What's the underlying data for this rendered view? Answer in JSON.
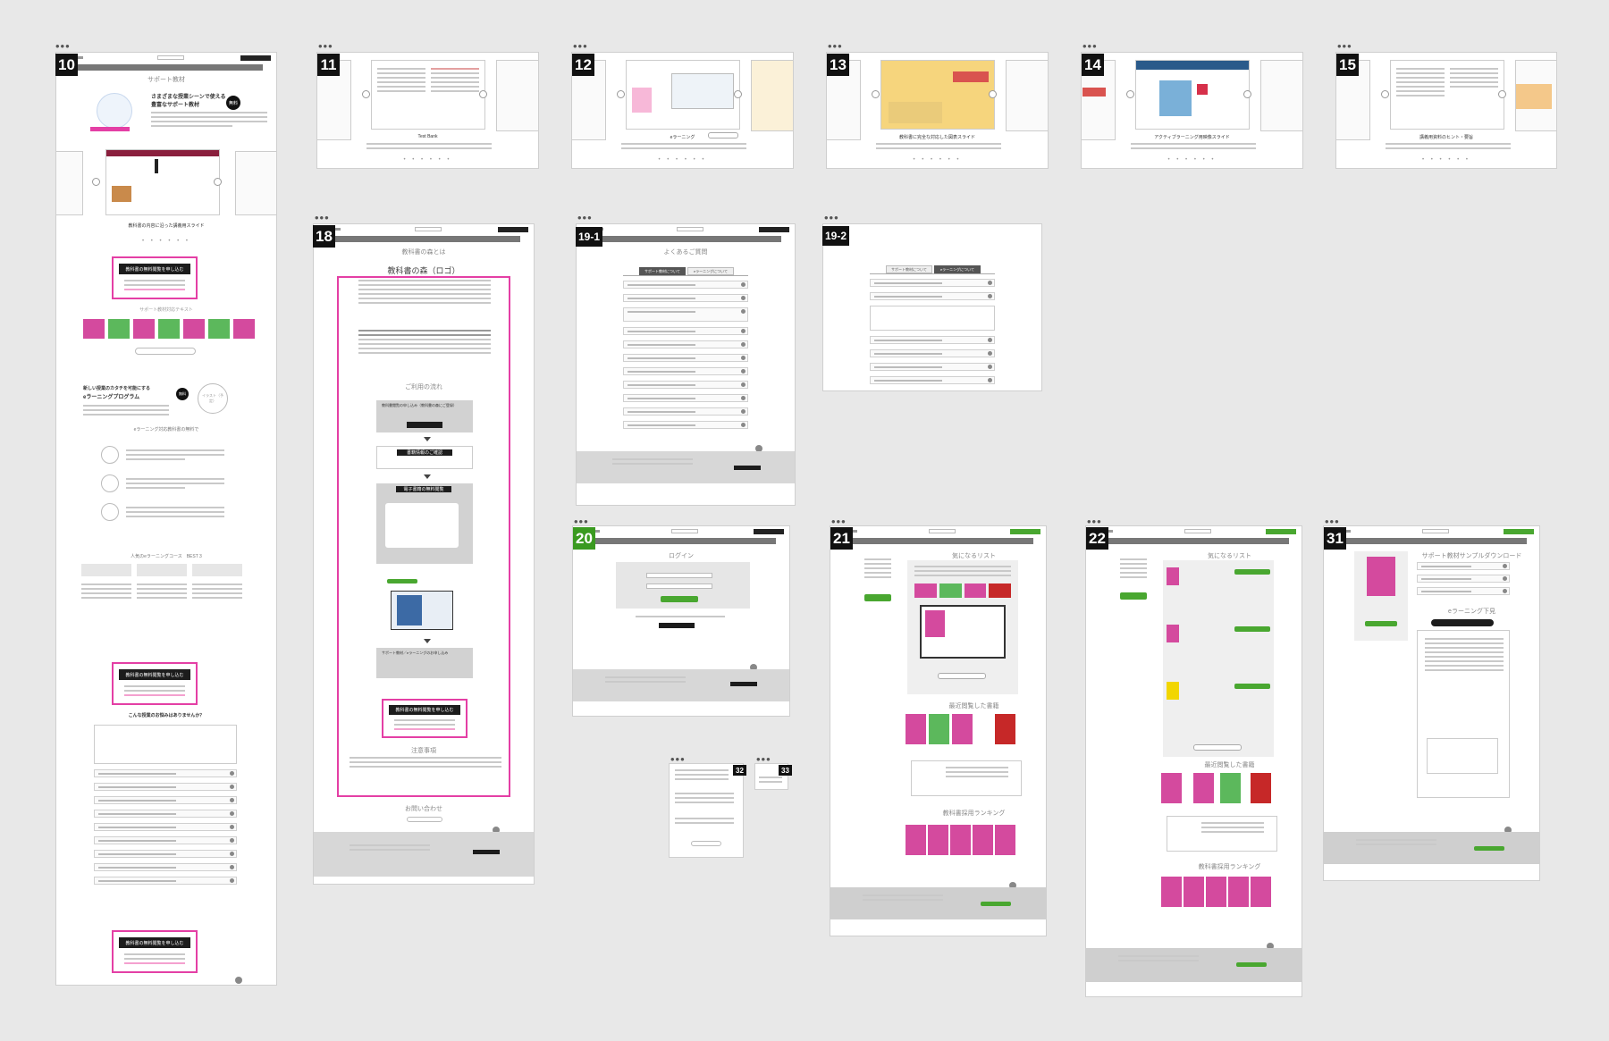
{
  "boards": [
    {
      "id": "10",
      "label": "10",
      "green": false
    },
    {
      "id": "11",
      "label": "11",
      "green": false
    },
    {
      "id": "12",
      "label": "12",
      "green": false
    },
    {
      "id": "13",
      "label": "13",
      "green": false
    },
    {
      "id": "14",
      "label": "14",
      "green": false
    },
    {
      "id": "15",
      "label": "15",
      "green": false
    },
    {
      "id": "18",
      "label": "18",
      "green": false
    },
    {
      "id": "19-1",
      "label": "19-1",
      "green": false
    },
    {
      "id": "19-2",
      "label": "19-2",
      "green": false
    },
    {
      "id": "20",
      "label": "20",
      "green": true
    },
    {
      "id": "21",
      "label": "21",
      "green": false
    },
    {
      "id": "22",
      "label": "22",
      "green": false
    },
    {
      "id": "31",
      "label": "31",
      "green": false
    },
    {
      "id": "32",
      "label": "32",
      "green": false
    },
    {
      "id": "33",
      "label": "33",
      "green": false
    }
  ],
  "dots_text": "•••",
  "board10": {
    "title": "サポート教材",
    "hero_heading_1": "さまざまな授業シーンで使える",
    "hero_heading_2": "豊富なサポート教材",
    "badge_text": "無料",
    "slider_caption": "教科書の内容に沿った講義用スライド",
    "cta": "教科書の無料閲覧を申し込む",
    "list_heading": "サポート教材対応テキスト",
    "elearn_heading_1": "新しい授業のカタチを可能にする",
    "elearn_heading_2": "eラーニングプログラム",
    "illust_label": "イラスト（予定）",
    "course_heading": "eラーニング対応教科書の無料で",
    "ranking_heading": "人気のeラーニングコース　BEST 3",
    "faq_heading": "こんな授業のお悩みはありませんか？"
  },
  "board11": {
    "caption": "Test Bank"
  },
  "board12": {
    "caption": "eラーニング"
  },
  "board13": {
    "caption": "教科書に完全な対応した図表スライド"
  },
  "board14": {
    "caption": "アクティブラーニング用映像スライド"
  },
  "board15": {
    "caption": "講義用資料のヒント・要旨"
  },
  "board18": {
    "top_label": "教科書の森とは",
    "logo_title": "教科書の森（ロゴ）",
    "flow_heading": "ご利用の流れ",
    "step1": "教科書閲覧の申し込み（教科書の森にご登録）",
    "step2": "書籍情報のご確認",
    "step3": "電子書籍の無料閲覧",
    "step4": "サポート教材／eラーニングのお申し込み",
    "cta": "教科書の無料閲覧を申し込む",
    "notes": "注意事項",
    "contact": "お問い合わせ"
  },
  "board19_1": {
    "title": "よくあるご質問",
    "tab1": "サポート教材について",
    "tab2": "eラーニングについて"
  },
  "board19_2": {
    "tab1": "サポート教材について",
    "tab2": "eラーニングについて"
  },
  "board20": {
    "title": "ログイン"
  },
  "board21": {
    "heading": "気になるリスト",
    "new_heading": "最近閲覧した書籍",
    "ranking": "教科書採用ランキング"
  },
  "board22": {
    "heading": "気になるリスト",
    "new_heading": "最近閲覧した書籍",
    "ranking": "教科書採用ランキング"
  },
  "board31": {
    "heading": "サポート教材サンプルダウンロード",
    "elearn": "eラーニング下見"
  },
  "colors": {
    "pink": "#e43fa5",
    "green": "#49a730",
    "black": "#111111",
    "bg": "#e8e8e8"
  }
}
